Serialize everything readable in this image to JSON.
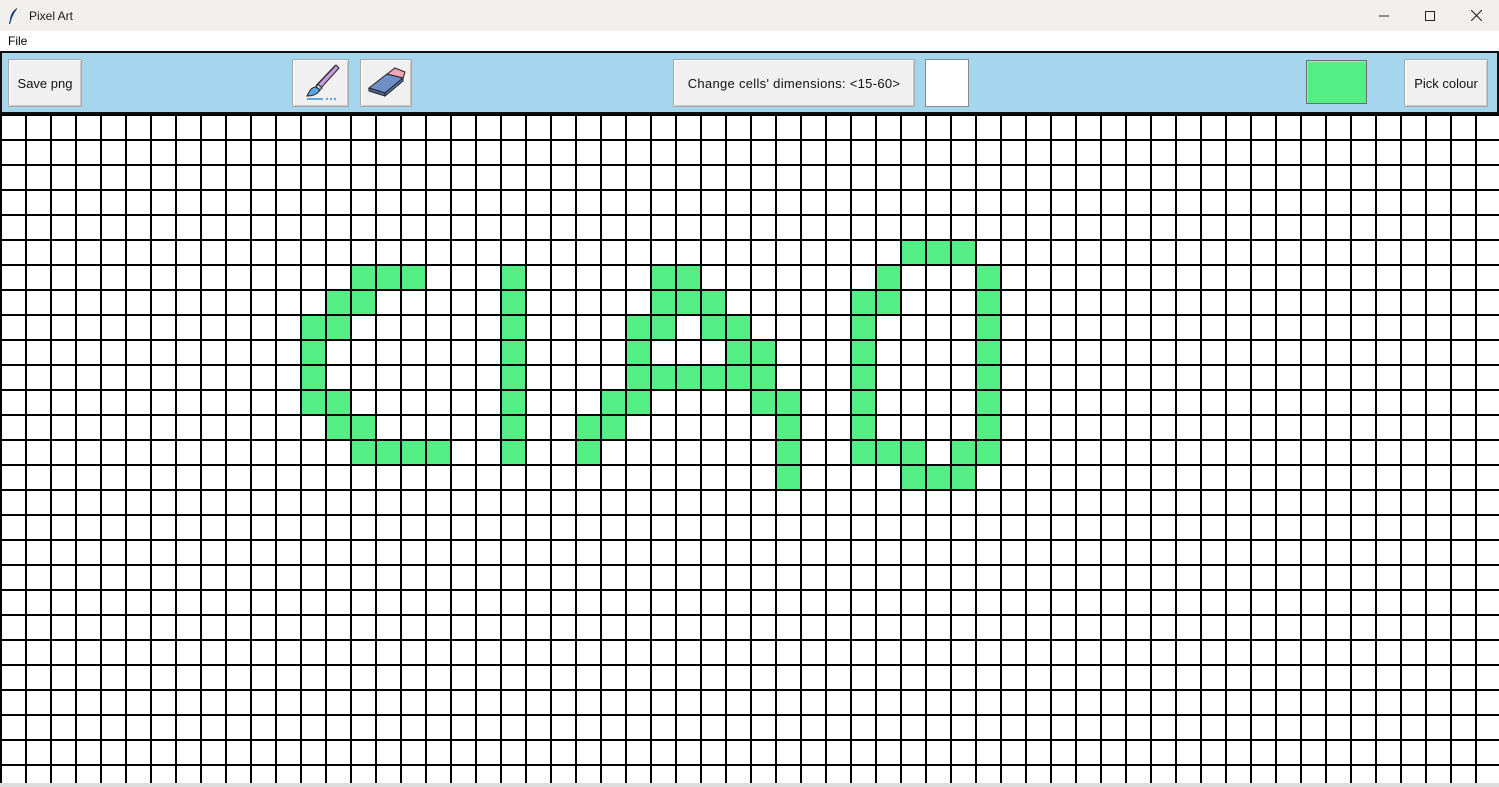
{
  "window": {
    "title": "Pixel Art",
    "app_icon": "feather-icon",
    "controls": [
      "minimize-icon",
      "maximize-icon",
      "close-icon"
    ]
  },
  "menu": {
    "items": [
      {
        "label": "File"
      }
    ]
  },
  "toolbar": {
    "save_label": "Save png",
    "brush_icon": "paintbrush-icon",
    "eraser_icon": "eraser-icon",
    "dimensions_label": "Change cells' dimensions: <15-60>",
    "dimensions_value": "",
    "current_colour": "#53ef85",
    "pick_label": "Pick colour"
  },
  "colors": {
    "toolbar_bg": "#a5d6ee",
    "grid_line": "#000000",
    "cell_empty": "#ffffff",
    "cell_painted": "#53ef85"
  },
  "canvas": {
    "columns": 60,
    "rows": 27,
    "painted_cells": [
      [
        14,
        6
      ],
      [
        15,
        6
      ],
      [
        16,
        6
      ],
      [
        13,
        7
      ],
      [
        14,
        7
      ],
      [
        12,
        8
      ],
      [
        13,
        8
      ],
      [
        12,
        9
      ],
      [
        12,
        10
      ],
      [
        12,
        11
      ],
      [
        13,
        11
      ],
      [
        13,
        12
      ],
      [
        14,
        12
      ],
      [
        14,
        13
      ],
      [
        15,
        13
      ],
      [
        16,
        13
      ],
      [
        17,
        13
      ],
      [
        20,
        6
      ],
      [
        20,
        7
      ],
      [
        20,
        8
      ],
      [
        20,
        9
      ],
      [
        20,
        10
      ],
      [
        20,
        11
      ],
      [
        20,
        12
      ],
      [
        20,
        13
      ],
      [
        26,
        6
      ],
      [
        27,
        6
      ],
      [
        26,
        7
      ],
      [
        27,
        7
      ],
      [
        28,
        7
      ],
      [
        25,
        8
      ],
      [
        26,
        8
      ],
      [
        28,
        8
      ],
      [
        29,
        8
      ],
      [
        25,
        9
      ],
      [
        29,
        9
      ],
      [
        30,
        9
      ],
      [
        25,
        10
      ],
      [
        26,
        10
      ],
      [
        27,
        10
      ],
      [
        28,
        10
      ],
      [
        29,
        10
      ],
      [
        30,
        10
      ],
      [
        24,
        11
      ],
      [
        25,
        11
      ],
      [
        30,
        11
      ],
      [
        31,
        11
      ],
      [
        23,
        12
      ],
      [
        24,
        12
      ],
      [
        31,
        12
      ],
      [
        23,
        13
      ],
      [
        31,
        13
      ],
      [
        31,
        14
      ],
      [
        36,
        5
      ],
      [
        37,
        5
      ],
      [
        38,
        5
      ],
      [
        35,
        6
      ],
      [
        39,
        6
      ],
      [
        34,
        7
      ],
      [
        35,
        7
      ],
      [
        39,
        7
      ],
      [
        34,
        8
      ],
      [
        39,
        8
      ],
      [
        34,
        9
      ],
      [
        39,
        9
      ],
      [
        34,
        10
      ],
      [
        39,
        10
      ],
      [
        34,
        11
      ],
      [
        39,
        11
      ],
      [
        34,
        12
      ],
      [
        39,
        12
      ],
      [
        34,
        13
      ],
      [
        35,
        13
      ],
      [
        36,
        13
      ],
      [
        38,
        13
      ],
      [
        39,
        13
      ],
      [
        36,
        14
      ],
      [
        37,
        14
      ],
      [
        38,
        14
      ]
    ]
  }
}
